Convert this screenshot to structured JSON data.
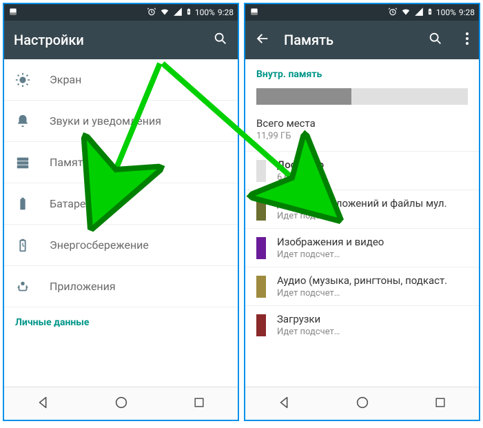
{
  "status": {
    "battery_pct": "100%",
    "time": "9:28"
  },
  "left": {
    "title": "Настройки",
    "items": [
      {
        "label": "Экран"
      },
      {
        "label": "Звуки и уведомления"
      },
      {
        "label": "Память"
      },
      {
        "label": "Батарея"
      },
      {
        "label": "Энергосбережение"
      },
      {
        "label": "Приложения"
      }
    ],
    "section": "Личные данные"
  },
  "right": {
    "title": "Память",
    "header": "Внутр. память",
    "total": {
      "label": "Всего места",
      "value": "11,99 ГБ"
    },
    "available": {
      "label": "Доступно",
      "value": "6,63 ГБ",
      "color": "#e0e0e0"
    },
    "categories": [
      {
        "label": "Данные приложений и файлы мул.",
        "sub": "Идет подсчет…",
        "color": "#6b6f2f"
      },
      {
        "label": "Изображения и видео",
        "sub": "Идет подсчет…",
        "color": "#6a1b9a"
      },
      {
        "label": "Аудио (музыка, рингтоны, подкаст.",
        "sub": "Идет подсчет…",
        "color": "#9e8b3f"
      },
      {
        "label": "Загрузки",
        "sub": "Идет подсчет…",
        "color": "#8b2a2a"
      }
    ]
  }
}
